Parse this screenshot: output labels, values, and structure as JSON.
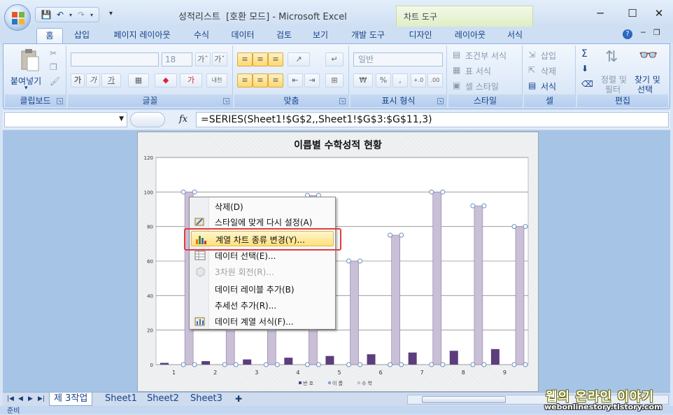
{
  "window": {
    "title": "성적리스트  [호환 모드] - Microsoft Excel",
    "contextual_tab_group": "차트 도구",
    "minimize": "─",
    "maximize": "☐",
    "close": "✕"
  },
  "tabs": [
    "홈",
    "삽입",
    "페이지 레이아웃",
    "수식",
    "데이터",
    "검토",
    "보기",
    "개발 도구",
    "디자인",
    "레이아웃",
    "서식"
  ],
  "ribbon": {
    "clipboard": {
      "label": "클립보드",
      "paste": "붙여넣기"
    },
    "font": {
      "label": "글꼴",
      "size": "18",
      "bold": "가",
      "italic": "가",
      "underline": "가"
    },
    "alignment": {
      "label": "맞춤"
    },
    "number": {
      "label": "표시 형식",
      "format": "일반",
      "currency": "₩",
      "percent": "%",
      "comma": ","
    },
    "styles": {
      "label": "스타일",
      "conditional": "조건부 서식",
      "table": "표 서식",
      "cell": "셀 스타일"
    },
    "cells": {
      "label": "셀",
      "insert": "삽입",
      "delete": "삭제",
      "format": "서식"
    },
    "editing": {
      "label": "편집",
      "sum": "Σ",
      "sort": "정렬 및",
      "sort2": "필터",
      "find": "찾기 및",
      "find2": "선택"
    }
  },
  "formula_bar": {
    "fx": "fx",
    "formula": "=SERIES(Sheet1!$G$2,,Sheet1!$G$3:$G$11,3)"
  },
  "chart_data": {
    "type": "bar",
    "title": "이름별 수학성적 현황",
    "categories": [
      "1",
      "2",
      "3",
      "4",
      "5",
      "6",
      "7",
      "8",
      "9"
    ],
    "series": [
      {
        "name": "번 호",
        "values": [
          1,
          2,
          3,
          4,
          5,
          6,
          7,
          8,
          9
        ],
        "color": "#5c3d7e"
      },
      {
        "name": "이 름",
        "values": [
          0,
          0,
          0,
          0,
          0,
          0,
          0,
          0,
          0
        ],
        "color": "#8aa8cf"
      },
      {
        "name": "수 학",
        "values": [
          100,
          70,
          65,
          98,
          60,
          75,
          100,
          92,
          80
        ],
        "color": "#c9bfd6"
      }
    ],
    "ylim": [
      0,
      120
    ],
    "yticks": [
      "0",
      "20",
      "40",
      "60",
      "80",
      "100",
      "120"
    ],
    "grid": true,
    "legend": "bottom"
  },
  "context_menu": {
    "items": [
      {
        "label": "삭제(D)",
        "icon": "none",
        "disabled": false
      },
      {
        "label": "스타일에 맞게 다시 설정(A)",
        "icon": "reset-style-icon",
        "disabled": false
      },
      {
        "label": "계열 차트 종류 변경(Y)...",
        "icon": "chart-type-icon",
        "disabled": false,
        "highlighted": true
      },
      {
        "label": "데이터 선택(E)...",
        "icon": "select-data-icon",
        "disabled": false
      },
      {
        "label": "3차원 회전(R)...",
        "icon": "rotate-3d-icon",
        "disabled": true
      },
      {
        "label": "데이터 레이블 추가(B)",
        "icon": "none",
        "disabled": false
      },
      {
        "label": "추세선 추가(R)...",
        "icon": "none",
        "disabled": false
      },
      {
        "label": "데이터 계열 서식(F)...",
        "icon": "format-series-icon",
        "disabled": false
      }
    ]
  },
  "sheets": [
    "제 3작업",
    "Sheet1",
    "Sheet2",
    "Sheet3"
  ],
  "status": "준비",
  "watermark": {
    "line1": "웹의 온라인 이야기",
    "line2": "webonlinestory.tistory.com"
  }
}
